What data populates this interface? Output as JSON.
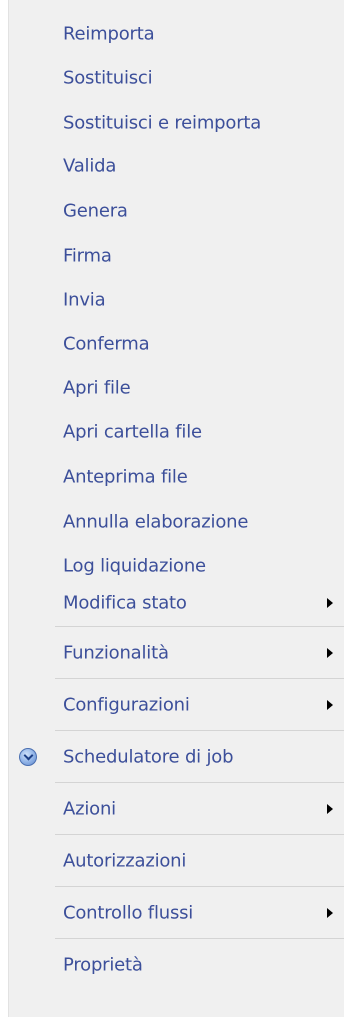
{
  "menu": {
    "items": [
      {
        "label": "Reimporta"
      },
      {
        "label": "Sostituisci"
      },
      {
        "label": "Sostituisci e reimporta"
      },
      {
        "label": "Valida"
      },
      {
        "label": "Genera"
      },
      {
        "label": "Firma"
      },
      {
        "label": "Invia"
      },
      {
        "label": "Conferma"
      },
      {
        "label": "Apri file"
      },
      {
        "label": "Apri cartella file"
      },
      {
        "label": "Anteprima file"
      },
      {
        "label": "Annulla elaborazione"
      },
      {
        "label": "Log liquidazione"
      },
      {
        "label": "Modifica stato"
      },
      {
        "label": "Funzionalità"
      },
      {
        "label": "Configurazioni"
      },
      {
        "label": "Schedulatore di job",
        "icon": "clock-icon"
      },
      {
        "label": "Azioni"
      },
      {
        "label": "Autorizzazioni"
      },
      {
        "label": "Controllo flussi"
      },
      {
        "label": "Proprietà"
      }
    ]
  },
  "colors": {
    "menu_background": "#f0f0f0",
    "text": "#3c4f9a",
    "separator": "#d4d4d4"
  }
}
